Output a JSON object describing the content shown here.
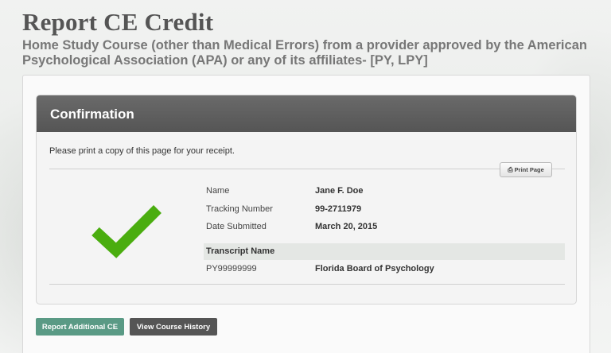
{
  "page": {
    "title": "Report CE Credit",
    "subtitle": "Home Study Course (other than Medical Errors) from a provider approved by the American Psychological Association (APA) or any of its affiliates- [PY, LPY]"
  },
  "confirmation": {
    "header": "Confirmation",
    "receipt_note": "Please print a copy of this page for your receipt.",
    "print_button_label": "Print Page",
    "fields": [
      {
        "label": "Name",
        "value": "Jane F. Doe"
      },
      {
        "label": "Tracking Number",
        "value": "99-2711979"
      },
      {
        "label": "Date Submitted",
        "value": "March 20, 2015"
      }
    ],
    "transcript": {
      "header": "Transcript Name",
      "id": "PY99999999",
      "board": "Florida Board of Psychology"
    }
  },
  "actions": {
    "report_additional": "Report Additional CE",
    "view_history": "View Course History"
  },
  "colors": {
    "check_green": "#4aad0f",
    "report_button": "#5a9a85",
    "history_button": "#555555",
    "panel_header": "#5f5f5f"
  },
  "icons": {
    "check": "checkmark-icon",
    "print": "printer-icon"
  }
}
